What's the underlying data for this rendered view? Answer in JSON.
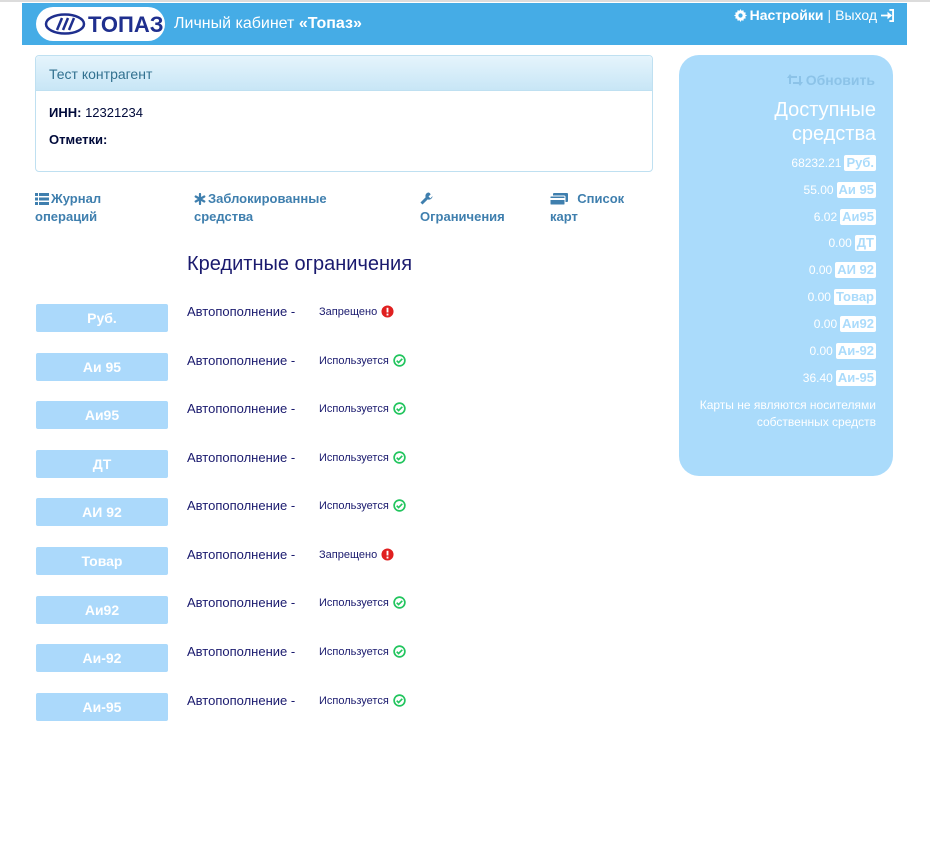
{
  "header": {
    "logo_text": "ТОПАЗ",
    "title_prefix": "Личный кабинет ",
    "title_brand": "«Топаз»",
    "settings_label": "Настройки",
    "separator": "|",
    "logout_label": "Выход"
  },
  "client": {
    "name": "Тест контрагент",
    "inn_label": "ИНН:",
    "inn_value": "12321234",
    "marks_label": "Отметки:"
  },
  "nav": {
    "journal": [
      "Журнал",
      "операций"
    ],
    "blocked": [
      "Заблокированные",
      "средства"
    ],
    "limits": "Ограничения",
    "cards": [
      "Список",
      "карт"
    ]
  },
  "credit": {
    "title": "Кредитные ограничения",
    "rows": [
      {
        "product": "Руб.",
        "label": "Автопополнение -",
        "status": "Запрещено",
        "ok": false
      },
      {
        "product": "Аи 95",
        "label": "Автопополнение -",
        "status": "Используется",
        "ok": true
      },
      {
        "product": "Аи95",
        "label": "Автопополнение -",
        "status": "Используется",
        "ok": true
      },
      {
        "product": "ДТ",
        "label": "Автопополнение -",
        "status": "Используется",
        "ok": true
      },
      {
        "product": "АИ 92",
        "label": "Автопополнение -",
        "status": "Используется",
        "ok": true
      },
      {
        "product": "Товар",
        "label": "Автопополнение -",
        "status": "Запрещено",
        "ok": false
      },
      {
        "product": "Аи92",
        "label": "Автопополнение -",
        "status": "Используется",
        "ok": true
      },
      {
        "product": "Аи-92",
        "label": "Автопополнение -",
        "status": "Используется",
        "ok": true
      },
      {
        "product": "Аи-95",
        "label": "Автопополнение -",
        "status": "Используется",
        "ok": true
      }
    ]
  },
  "funds": {
    "refresh_label": "Обновить",
    "title": "Доступные средства",
    "items": [
      {
        "amount": "68232.21",
        "product": "Руб."
      },
      {
        "amount": "55.00",
        "product": "Аи 95"
      },
      {
        "amount": "6.02",
        "product": "Аи95"
      },
      {
        "amount": "0.00",
        "product": "ДТ"
      },
      {
        "amount": "0.00",
        "product": "АИ 92"
      },
      {
        "amount": "0.00",
        "product": "Товар"
      },
      {
        "amount": "0.00",
        "product": "Аи92"
      },
      {
        "amount": "0.00",
        "product": "Аи-92"
      },
      {
        "amount": "36.40",
        "product": "Аи-95"
      }
    ],
    "note": "Карты не являются носителями собственных средств"
  },
  "colors": {
    "header_bg": "#45ace6",
    "button_bg": "#abd9fb",
    "ok": "#22c55e",
    "forbidden": "#e02020"
  },
  "icons": {
    "settings": "gear-icon",
    "logout": "sign-in-icon",
    "journal": "list-icon",
    "blocked": "asterisk-icon",
    "limits": "wrench-icon",
    "cards": "credit-card-icon",
    "refresh": "retweet-icon",
    "ok": "check-circle-icon",
    "forbidden": "exclamation-circle-icon"
  }
}
